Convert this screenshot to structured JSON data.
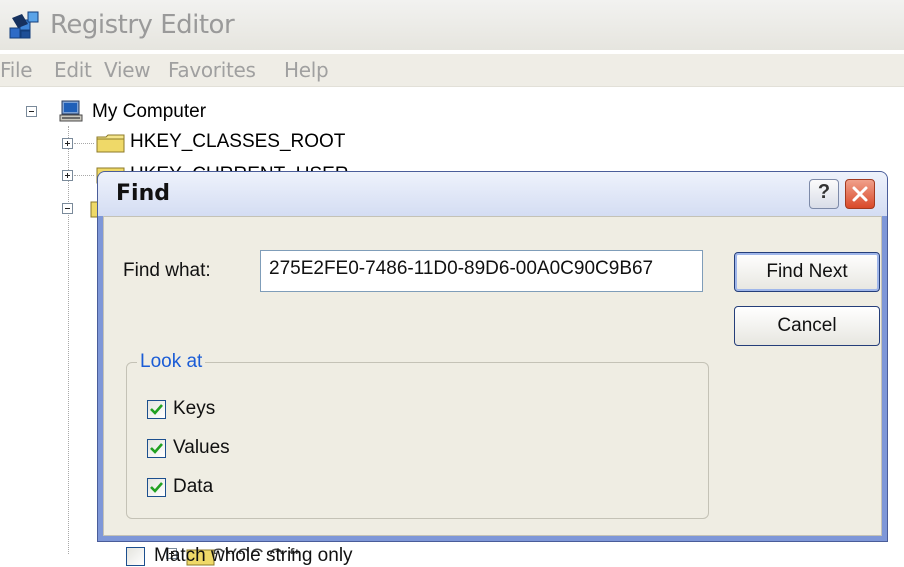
{
  "window": {
    "title": "Registry Editor",
    "icon": "registry-editor-icon"
  },
  "menu": {
    "items": [
      "File",
      "Edit",
      "View",
      "Favorites",
      "Help"
    ]
  },
  "tree": {
    "root_label": "My Computer",
    "nodes": [
      {
        "label": "HKEY_CLASSES_ROOT",
        "state": "collapsed"
      },
      {
        "label": "HKEY_CURRENT_USER",
        "state": "collapsed"
      },
      {
        "label": "",
        "state": "expanded"
      }
    ],
    "bottom_partial_label": "SYSC.O.ft"
  },
  "find_dialog": {
    "title": "Find",
    "find_what_label": "Find what:",
    "find_what_value": "275E2FE0-7486-11D0-89D6-00A0C90C9B67",
    "find_next_label": "Find Next",
    "cancel_label": "Cancel",
    "look_at": {
      "legend": "Look at",
      "options": [
        {
          "label": "Keys",
          "checked": true
        },
        {
          "label": "Values",
          "checked": true
        },
        {
          "label": "Data",
          "checked": true
        }
      ]
    },
    "match_whole": {
      "label": "Match whole string only",
      "checked": false
    }
  },
  "colors": {
    "dialog_frame": "#7e97d8",
    "close_button": "#d9492a",
    "group_legend": "#1a5cd6",
    "check_mark": "#21a121"
  }
}
